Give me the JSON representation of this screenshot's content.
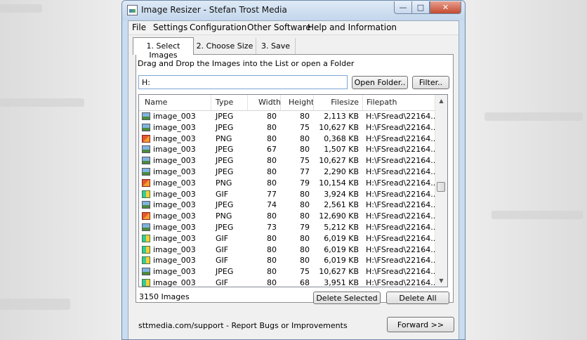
{
  "window": {
    "title": "Image Resizer - Stefan Trost Media",
    "min_glyph": "—",
    "max_glyph": "□",
    "close_glyph": "✕"
  },
  "menu": [
    "File",
    "Settings",
    "Configuration",
    "Other Software",
    "Help and Information"
  ],
  "tabs": [
    "1. Select Images",
    "2. Choose Size",
    "3. Save"
  ],
  "instructions": "Drag and Drop the Images into the List or open a Folder",
  "path_input": {
    "value": "H:"
  },
  "buttons": {
    "open_folder": "Open Folder..",
    "filter": "Filter..",
    "delete_selected": "Delete Selected",
    "delete_all": "Delete All",
    "forward": "Forward >>"
  },
  "columns": [
    "Name",
    "Type",
    "Width",
    "Height",
    "Filesize",
    "Filepath"
  ],
  "rows": [
    {
      "icon": "jpeg",
      "name": "image_003",
      "type": "JPEG",
      "width": "80",
      "height": "80",
      "size": "2,113 KB",
      "path": "H:\\FSread\\22164..."
    },
    {
      "icon": "jpeg",
      "name": "image_003",
      "type": "JPEG",
      "width": "80",
      "height": "75",
      "size": "10,627 KB",
      "path": "H:\\FSread\\22164..."
    },
    {
      "icon": "png",
      "name": "image_003",
      "type": "PNG",
      "width": "80",
      "height": "80",
      "size": "0,368 KB",
      "path": "H:\\FSread\\22164..."
    },
    {
      "icon": "jpeg",
      "name": "image_003",
      "type": "JPEG",
      "width": "67",
      "height": "80",
      "size": "1,507 KB",
      "path": "H:\\FSread\\22164..."
    },
    {
      "icon": "jpeg",
      "name": "image_003",
      "type": "JPEG",
      "width": "80",
      "height": "75",
      "size": "10,627 KB",
      "path": "H:\\FSread\\22164..."
    },
    {
      "icon": "jpeg",
      "name": "image_003",
      "type": "JPEG",
      "width": "80",
      "height": "77",
      "size": "2,290 KB",
      "path": "H:\\FSread\\22164..."
    },
    {
      "icon": "png",
      "name": "image_003",
      "type": "PNG",
      "width": "80",
      "height": "79",
      "size": "10,154 KB",
      "path": "H:\\FSread\\22164..."
    },
    {
      "icon": "gif",
      "name": "image_003",
      "type": "GIF",
      "width": "77",
      "height": "80",
      "size": "3,924 KB",
      "path": "H:\\FSread\\22164..."
    },
    {
      "icon": "jpeg",
      "name": "image_003",
      "type": "JPEG",
      "width": "74",
      "height": "80",
      "size": "2,561 KB",
      "path": "H:\\FSread\\22164..."
    },
    {
      "icon": "png",
      "name": "image_003",
      "type": "PNG",
      "width": "80",
      "height": "80",
      "size": "12,690 KB",
      "path": "H:\\FSread\\22164..."
    },
    {
      "icon": "jpeg",
      "name": "image_003",
      "type": "JPEG",
      "width": "73",
      "height": "79",
      "size": "5,212 KB",
      "path": "H:\\FSread\\22164..."
    },
    {
      "icon": "gif",
      "name": "image_003",
      "type": "GIF",
      "width": "80",
      "height": "80",
      "size": "6,019 KB",
      "path": "H:\\FSread\\22164..."
    },
    {
      "icon": "gif",
      "name": "image_003",
      "type": "GIF",
      "width": "80",
      "height": "80",
      "size": "6,019 KB",
      "path": "H:\\FSread\\22164..."
    },
    {
      "icon": "gif",
      "name": "image_003",
      "type": "GIF",
      "width": "80",
      "height": "80",
      "size": "6,019 KB",
      "path": "H:\\FSread\\22164..."
    },
    {
      "icon": "jpeg",
      "name": "image_003",
      "type": "JPEG",
      "width": "80",
      "height": "75",
      "size": "10,627 KB",
      "path": "H:\\FSread\\22164..."
    },
    {
      "icon": "gif",
      "name": "image_003",
      "type": "GIF",
      "width": "80",
      "height": "68",
      "size": "3,951 KB",
      "path": "H:\\FSread\\22164..."
    }
  ],
  "image_count": "3150 Images",
  "footer_link": "sttmedia.com/support - Report Bugs or Improvements",
  "scroll": {
    "up_glyph": "▲",
    "down_glyph": "▼"
  }
}
